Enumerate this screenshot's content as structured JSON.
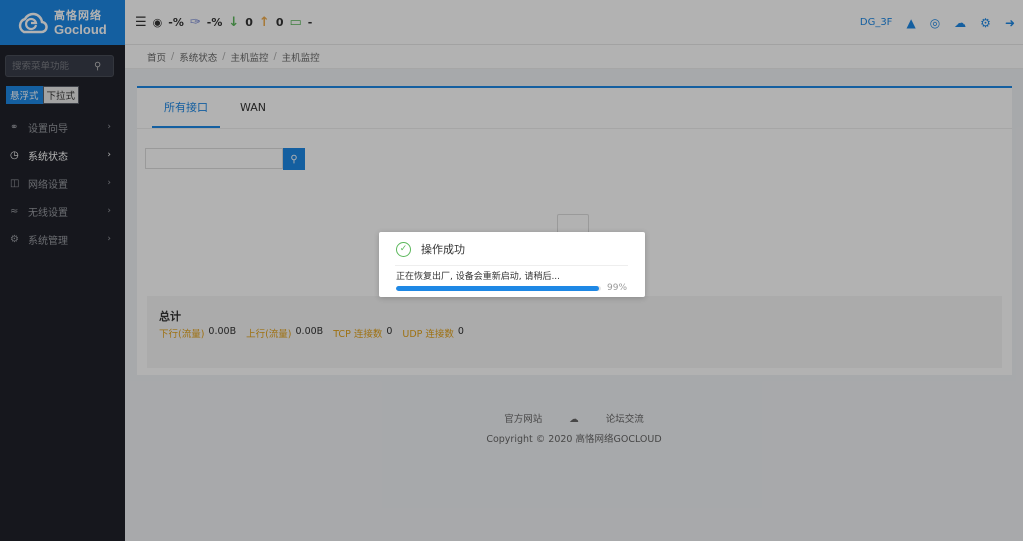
{
  "brand": {
    "name_cn": "高恪网络",
    "name_en": "Gocloud"
  },
  "sidebar": {
    "search_placeholder": "搜索菜单功能",
    "mode_options": [
      "悬浮式",
      "下拉式"
    ],
    "items": [
      {
        "label": "设置向导",
        "icon": "compass-icon"
      },
      {
        "label": "系统状态",
        "icon": "dashboard-icon"
      },
      {
        "label": "网络设置",
        "icon": "monitor-icon"
      },
      {
        "label": "无线设置",
        "icon": "wifi-icon"
      },
      {
        "label": "系统管理",
        "icon": "gear-icon"
      }
    ]
  },
  "topbar": {
    "cpu": "-%",
    "mem": "-%",
    "down": "0",
    "up": "0",
    "devices": "-",
    "user": "DG_3F"
  },
  "breadcrumb": [
    "首页",
    "系统状态",
    "主机监控",
    "主机监控"
  ],
  "tabs": [
    "所有接口",
    "WAN"
  ],
  "total": {
    "title": "总计",
    "down_label": "下行(流量)",
    "down_value": "0.00B",
    "up_label": "上行(流量)",
    "up_value": "0.00B",
    "tcp_label": "TCP 连接数",
    "tcp_value": "0",
    "udp_label": "UDP 连接数",
    "udp_value": "0"
  },
  "footer": {
    "link1": "官方网站",
    "link2": "论坛交流",
    "copyright": "Copyright © 2020 高恪网络GOCLOUD"
  },
  "dialog": {
    "title": "操作成功",
    "message": "正在恢复出厂, 设备会重新启动, 请稍后...",
    "progress_percent": 99,
    "progress_text": "99%"
  },
  "colors": {
    "accent": "#1e88e5",
    "success": "#5cb85c",
    "warning": "#e3a21a"
  }
}
